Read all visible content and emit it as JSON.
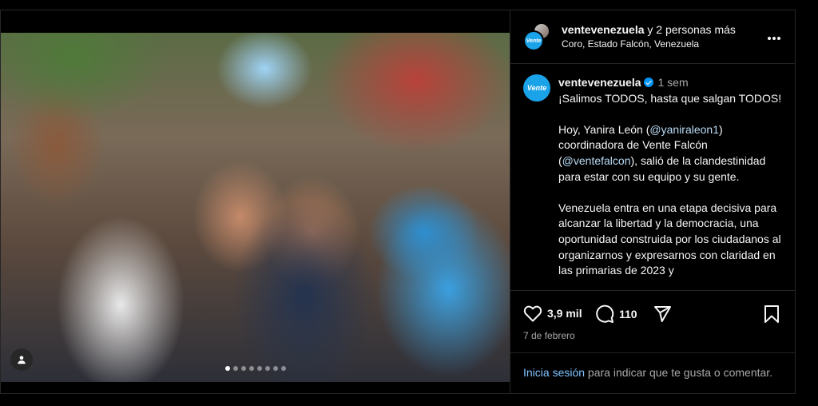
{
  "post": {
    "carousel": {
      "slide_count": 8,
      "active_index": 0
    },
    "header": {
      "username": "ventevenezuela",
      "coauthors_suffix": "y 2 personas más",
      "location": "Coro, Estado Falcón, Venezuela",
      "avatar_text": "Vente",
      "more_icon": "more-horizontal-icon"
    },
    "caption": {
      "avatar_text": "Vente",
      "username": "ventevenezuela",
      "time": "1 sem",
      "line1": "¡Salimos TODOS, hasta que salgan TODOS!",
      "p2_a": "Hoy, Yanira León (",
      "p2_mention1": "@yaniraleon1",
      "p2_b": ") coordinadora de Vente Falcón (",
      "p2_mention2": "@ventefalcon",
      "p2_c": "), salió de la clandestinidad para estar con su equipo y su gente.",
      "p3": "Venezuela entra en una etapa decisiva para alcanzar la libertad y la democracia, una oportunidad construida por los ciudadanos al organizarnos y expresarnos con claridad en las primarias de 2023 y"
    },
    "actions": {
      "likes": "3,9 mil",
      "comments": "110",
      "like_icon": "heart-icon",
      "comment_icon": "comment-icon",
      "share_icon": "send-icon",
      "save_icon": "bookmark-icon"
    },
    "date": "7 de febrero",
    "login": {
      "link": "Inicia sesión",
      "rest": " para indicar que te gusta o comentar."
    }
  },
  "colors": {
    "accent": "#0095f6",
    "brand": "#1aa3e8",
    "bg": "#000000"
  }
}
